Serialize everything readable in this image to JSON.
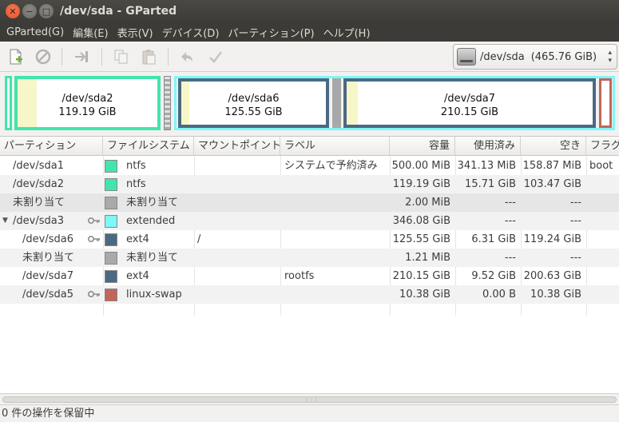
{
  "window": {
    "title": "/dev/sda - GParted"
  },
  "menubar": {
    "items": [
      "GParted(G)",
      "編集(E)",
      "表示(V)",
      "デバイス(D)",
      "パーティション(P)",
      "ヘルプ(H)"
    ]
  },
  "toolbar": {
    "device": {
      "name": "/dev/sda",
      "size": "(465.76 GiB)"
    }
  },
  "colors": {
    "ntfs": "#42e5ac",
    "extended": "#7ef7f7",
    "ext4": "#4b6983",
    "linux_swap": "#c1665a",
    "unallocated": "#a9a9a9"
  },
  "map": {
    "sda2": {
      "name": "/dev/sda2",
      "size": "119.19 GiB",
      "used_fraction": 0.13
    },
    "sda6": {
      "name": "/dev/sda6",
      "size": "125.55 GiB",
      "used_fraction": 0.05
    },
    "sda7": {
      "name": "/dev/sda7",
      "size": "210.15 GiB",
      "used_fraction": 0.045
    }
  },
  "table": {
    "headers": [
      "パーティション",
      "ファイルシステム",
      "マウントポイント",
      "ラベル",
      "容量",
      "使用済み",
      "空き",
      "フラグ"
    ],
    "rows": [
      {
        "partition": "/dev/sda1",
        "fs": "ntfs",
        "mount": "",
        "label": "システムで予約済み",
        "size": "500.00 MiB",
        "used": "341.13 MiB",
        "free": "158.87 MiB",
        "flags": "boot"
      },
      {
        "partition": "/dev/sda2",
        "fs": "ntfs",
        "mount": "",
        "label": "",
        "size": "119.19 GiB",
        "used": "15.71 GiB",
        "free": "103.47 GiB",
        "flags": ""
      },
      {
        "partition": "未割り当て",
        "fs": "未割り当て",
        "mount": "",
        "label": "",
        "size": "2.00 MiB",
        "used": "---",
        "free": "---",
        "flags": ""
      },
      {
        "partition": "/dev/sda3",
        "fs": "extended",
        "mount": "",
        "label": "",
        "size": "346.08 GiB",
        "used": "---",
        "free": "---",
        "flags": ""
      },
      {
        "partition": "/dev/sda6",
        "fs": "ext4",
        "mount": "/",
        "label": "",
        "size": "125.55 GiB",
        "used": "6.31 GiB",
        "free": "119.24 GiB",
        "flags": ""
      },
      {
        "partition": "未割り当て",
        "fs": "未割り当て",
        "mount": "",
        "label": "",
        "size": "1.21 MiB",
        "used": "---",
        "free": "---",
        "flags": ""
      },
      {
        "partition": "/dev/sda7",
        "fs": "ext4",
        "mount": "",
        "label": "rootfs",
        "size": "210.15 GiB",
        "used": "9.52 GiB",
        "free": "200.63 GiB",
        "flags": ""
      },
      {
        "partition": "/dev/sda5",
        "fs": "linux-swap",
        "mount": "",
        "label": "",
        "size": "10.38 GiB",
        "used": "0.00 B",
        "free": "10.38 GiB",
        "flags": ""
      }
    ]
  },
  "status": {
    "text": "0 件の操作を保留中"
  }
}
